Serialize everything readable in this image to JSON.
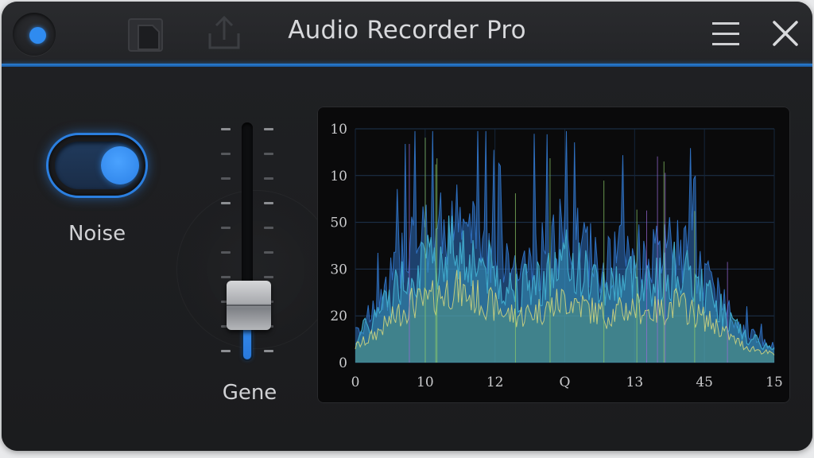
{
  "window": {
    "title": "Audio Recorder Pro"
  },
  "titlebar": {
    "icons": [
      "record-indicator-icon",
      "save-icon",
      "share-icon",
      "menu-icon",
      "close-icon"
    ]
  },
  "controls": {
    "noise_toggle": {
      "label": "Noise",
      "state": "on"
    },
    "gain_fader": {
      "label": "Gene",
      "level": 0.35
    }
  },
  "colors": {
    "accent": "#2f8bf0",
    "background": "#1e1f21",
    "chart_background": "#0a0a0b"
  },
  "chart_data": {
    "type": "area",
    "title": "",
    "xlabel": "",
    "ylabel": "",
    "x_tick_labels": [
      "0",
      "10",
      "12",
      "Q",
      "13",
      "45",
      "15"
    ],
    "y_tick_labels": [
      "0",
      "20",
      "30",
      "50",
      "10",
      "10"
    ],
    "y_range": [
      0,
      5
    ],
    "grid": true,
    "series_colors": [
      "#2e6fbf",
      "#3fa7c9",
      "#8fcf6a",
      "#e3e07a",
      "#9a6ad8"
    ],
    "envelope": {
      "x": [
        0,
        0.5,
        1,
        1.5,
        2,
        2.5,
        3,
        3.5,
        4,
        4.5,
        5,
        5.5,
        6,
        6.5,
        7,
        7.5,
        8,
        8.5,
        9,
        9.5,
        10,
        10.5,
        11,
        11.5,
        12,
        12.5,
        13,
        13.5,
        14,
        14.5,
        15
      ],
      "peak": [
        0.9,
        1.2,
        1.7,
        2.6,
        3.4,
        3.2,
        3.6,
        3.8,
        3.5,
        3.3,
        3.0,
        2.6,
        2.5,
        2.7,
        3.1,
        3.5,
        3.2,
        2.8,
        2.6,
        2.9,
        3.0,
        2.7,
        2.9,
        3.2,
        2.8,
        2.3,
        1.9,
        1.3,
        0.8,
        0.6,
        0.5
      ],
      "mean": [
        0.4,
        0.6,
        0.9,
        1.2,
        1.5,
        1.5,
        1.7,
        1.9,
        1.7,
        1.6,
        1.4,
        1.2,
        1.2,
        1.3,
        1.4,
        1.6,
        1.5,
        1.3,
        1.2,
        1.3,
        1.4,
        1.3,
        1.3,
        1.5,
        1.3,
        1.1,
        0.9,
        0.6,
        0.4,
        0.3,
        0.2
      ]
    }
  }
}
